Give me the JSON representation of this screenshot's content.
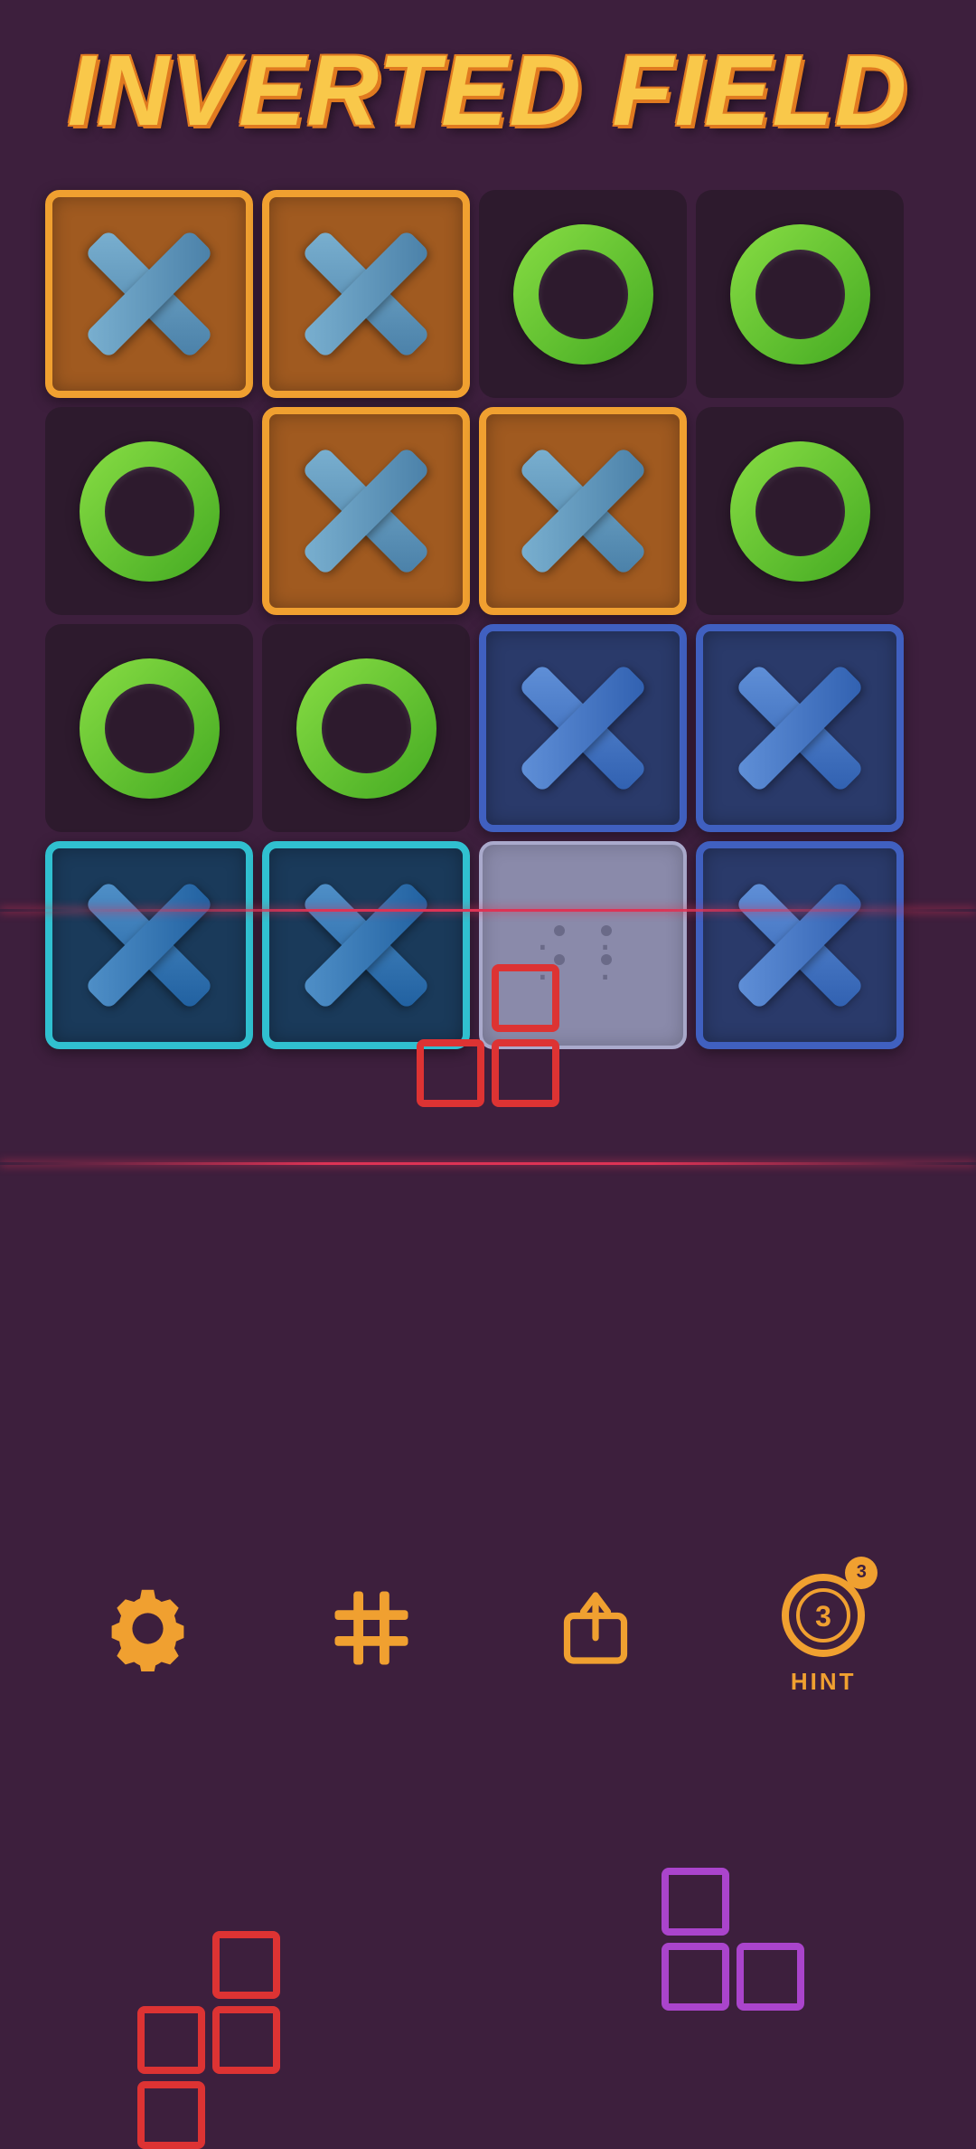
{
  "title": "INVERTED FIELD",
  "grid": {
    "rows": [
      [
        {
          "type": "orange-x",
          "symbol": "X"
        },
        {
          "type": "orange-x",
          "symbol": "X"
        },
        {
          "type": "empty-o",
          "symbol": "O"
        },
        {
          "type": "empty-o",
          "symbol": "O"
        }
      ],
      [
        {
          "type": "empty-o",
          "symbol": "O"
        },
        {
          "type": "orange-x",
          "symbol": "X"
        },
        {
          "type": "orange-x",
          "symbol": "X"
        },
        {
          "type": "empty-o",
          "symbol": "O"
        }
      ],
      [
        {
          "type": "empty-o",
          "symbol": "O"
        },
        {
          "type": "empty-o",
          "symbol": "O"
        },
        {
          "type": "blue-x",
          "symbol": "X"
        },
        {
          "type": "blue-x",
          "symbol": "X"
        }
      ],
      [
        {
          "type": "cyan-x",
          "symbol": "X"
        },
        {
          "type": "cyan-x",
          "symbol": "X"
        },
        {
          "type": "gray-empty",
          "symbol": ""
        },
        {
          "type": "blue-x",
          "symbol": "X"
        }
      ]
    ]
  },
  "pieces": [
    {
      "id": "red-piece",
      "color": "red",
      "shape": "s-tetromino"
    },
    {
      "id": "purple-piece",
      "color": "purple",
      "shape": "l-tetromino"
    }
  ],
  "toolbar": {
    "settings_label": "Settings",
    "levels_label": "Levels",
    "share_label": "Share",
    "hint_label": "HINT",
    "hint_count": "3"
  }
}
